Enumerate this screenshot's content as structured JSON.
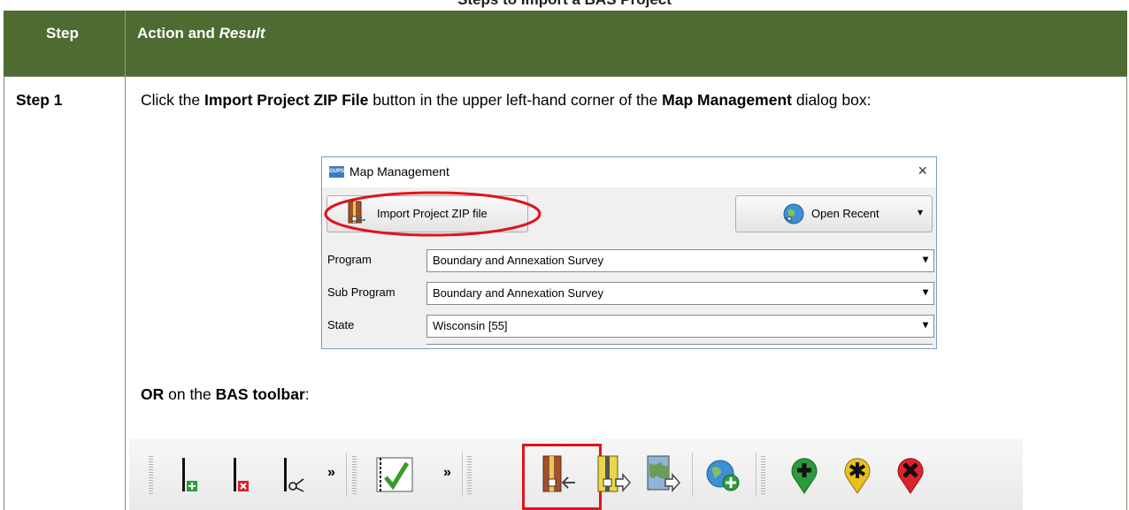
{
  "partial_title": "Steps to Import a BAS Project",
  "table": {
    "header_step": "Step",
    "header_action": "Action and ",
    "header_action_em": "Result"
  },
  "step1": {
    "label": "Step 1",
    "text_1": "Click the ",
    "bold_1": "Import Project ZIP File",
    "text_2": " button in the upper left-hand corner of the ",
    "bold_2": "Map Management",
    "text_3": " dialog box:",
    "or_bold": "OR",
    "or_text": " on the ",
    "toolbar_bold": "BAS toolbar",
    "toolbar_colon": ":"
  },
  "dialog": {
    "app_icon_text": "GUPS",
    "title": "Map Management",
    "close_glyph": "×",
    "import_button": "Import Project ZIP file",
    "open_recent_button": "Open Recent",
    "dropdown_glyph": "▾",
    "fields": [
      {
        "label": "Program",
        "value": "Boundary and Annexation Survey"
      },
      {
        "label": "Sub Program",
        "value": "Boundary and Annexation Survey"
      },
      {
        "label": "State",
        "value": "Wisconsin [55]"
      }
    ],
    "highlight_color": "#e0141c"
  },
  "toolbar": {
    "overflow_glyph": "»",
    "icons": [
      "add-line-icon",
      "delete-line-icon",
      "split-line-icon",
      "validate-icon",
      "import-zip-icon",
      "export-zip-icon",
      "export-map-icon",
      "add-web-service-icon",
      "add-point-icon",
      "modify-point-icon",
      "delete-point-icon"
    ],
    "highlight_color": "#e0141c"
  },
  "colors": {
    "header_bg": "#4e6b32"
  }
}
